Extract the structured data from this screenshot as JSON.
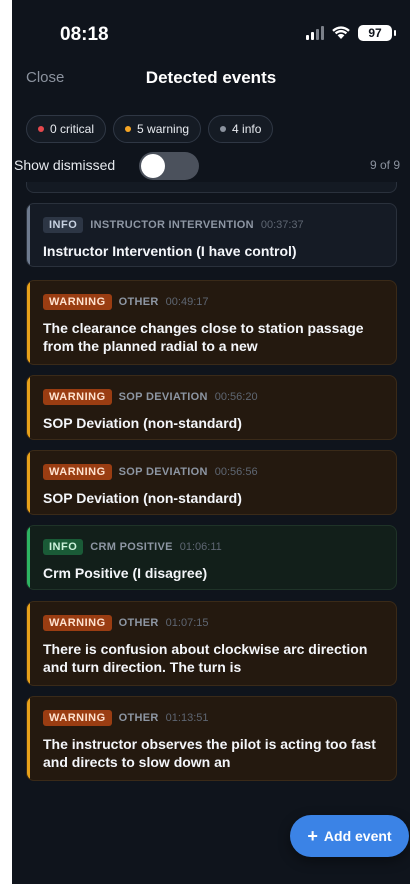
{
  "status_bar": {
    "time": "08:18",
    "battery": "97"
  },
  "header": {
    "close_label": "Close",
    "title": "Detected events"
  },
  "filters": [
    {
      "label": "0 critical",
      "color": "#e5484d"
    },
    {
      "label": "5 warning",
      "color": "#f5a524"
    },
    {
      "label": "4 info",
      "color": "#8b929e"
    }
  ],
  "toggle": {
    "label": "Show dismissed",
    "on": false
  },
  "count": "9 of 9",
  "events": [
    {
      "severity": "INFO",
      "kind": "info",
      "category": "INSTRUCTOR INTERVENTION",
      "time": "00:37:37",
      "title": "Instructor Intervention (I have control)"
    },
    {
      "severity": "WARNING",
      "kind": "warn",
      "category": "OTHER",
      "time": "00:49:17",
      "title": "The clearance changes close to station passage from the planned radial to a new"
    },
    {
      "severity": "WARNING",
      "kind": "warn",
      "category": "SOP DEVIATION",
      "time": "00:56:20",
      "title": "SOP Deviation (non-standard)"
    },
    {
      "severity": "WARNING",
      "kind": "warn",
      "category": "SOP DEVIATION",
      "time": "00:56:56",
      "title": "SOP Deviation (non-standard)"
    },
    {
      "severity": "INFO",
      "kind": "pos",
      "category": "CRM POSITIVE",
      "time": "01:06:11",
      "title": "Crm Positive (I disagree)"
    },
    {
      "severity": "WARNING",
      "kind": "warn",
      "category": "OTHER",
      "time": "01:07:15",
      "title": "There is confusion about clockwise arc direction and turn direction. The turn is"
    },
    {
      "severity": "WARNING",
      "kind": "warn",
      "category": "OTHER",
      "time": "01:13:51",
      "title": "The instructor observes the pilot is acting too fast and directs to slow down an"
    }
  ],
  "fab": {
    "plus": "+",
    "label": "Add event"
  }
}
